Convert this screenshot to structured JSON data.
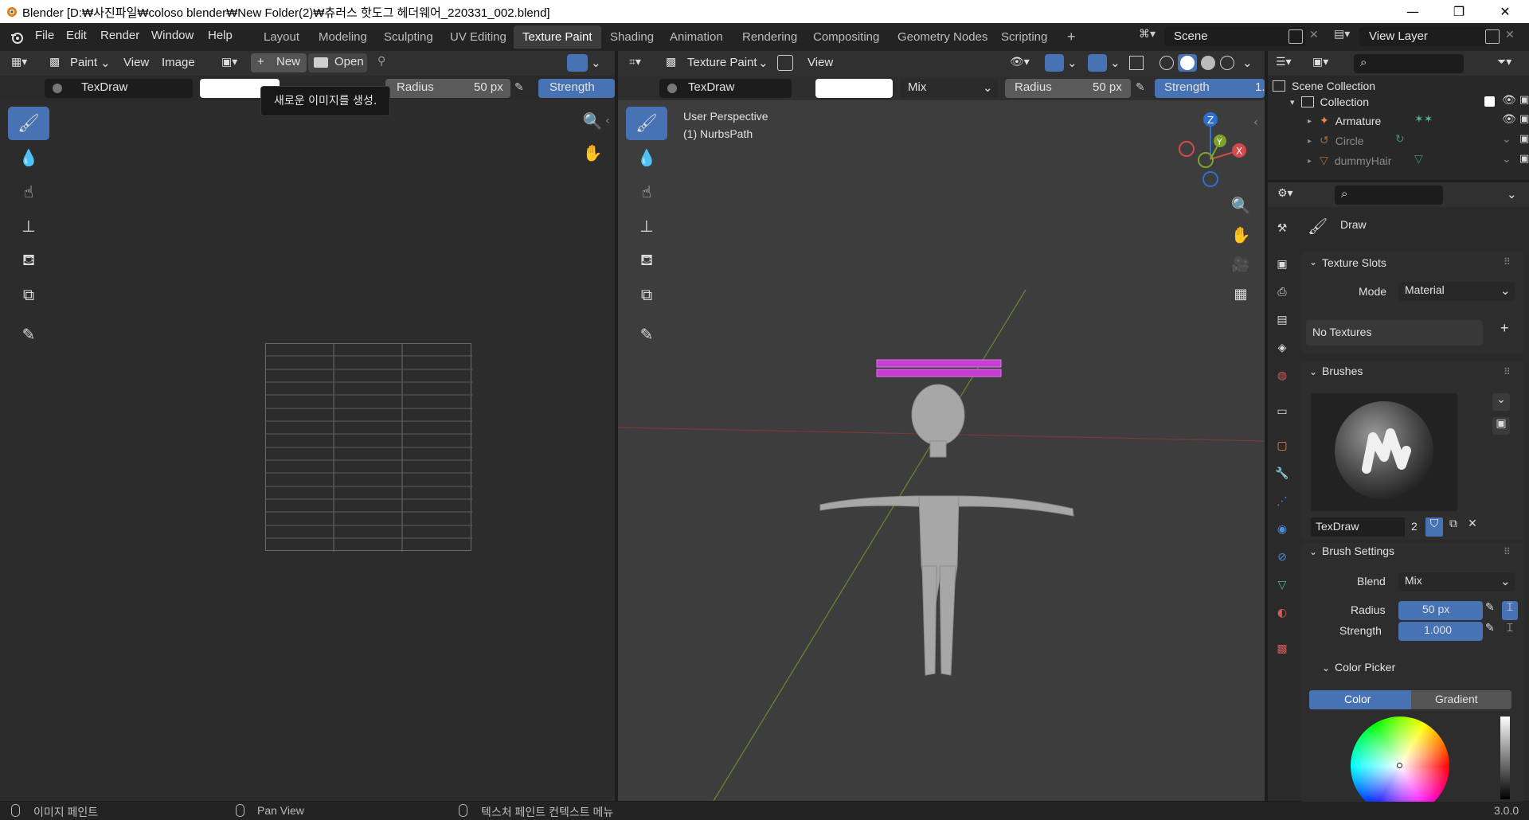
{
  "window": {
    "title": "Blender [D:₩사진파일₩coloso blender₩New Folder(2)₩츄러스 핫도그 헤더웨어_220331_002.blend]",
    "minimize": "—",
    "maximize": "❐",
    "close": "✕"
  },
  "menu": [
    "File",
    "Edit",
    "Render",
    "Window",
    "Help"
  ],
  "workspaces": {
    "tabs": [
      "Layout",
      "Modeling",
      "Sculpting",
      "UV Editing",
      "Texture Paint",
      "Shading",
      "Animation",
      "Rendering",
      "Compositing",
      "Geometry Nodes",
      "Scripting"
    ],
    "active": "Texture Paint",
    "add": "+"
  },
  "scene": {
    "name": "Scene"
  },
  "view_layer": {
    "name": "View Layer"
  },
  "image_editor": {
    "mode": "Paint",
    "menus": [
      "View",
      "Image"
    ],
    "new_label": "New",
    "open_label": "Open",
    "brush_name": "TexDraw",
    "radius_label": "Radius",
    "radius_value": "50 px",
    "strength_label": "Strength",
    "tooltip": "새로운 이미지를 생성."
  },
  "viewport": {
    "mode": "Texture Paint",
    "menu": "View",
    "brush_name": "TexDraw",
    "blend": "Mix",
    "radius_label": "Radius",
    "radius_value": "50 px",
    "strength_label": "Strength",
    "strength_value": "1.",
    "overlay_line1": "User Perspective",
    "overlay_line2": "(1) NurbsPath",
    "gizmo": {
      "x": "X",
      "y": "Y",
      "z": "Z"
    }
  },
  "outliner": {
    "scene_collection": "Scene Collection",
    "collection": "Collection",
    "items": [
      "Armature",
      "Circle",
      "dummyHair"
    ]
  },
  "properties": {
    "tool_name": "Draw",
    "texture_slots": {
      "title": "Texture Slots",
      "mode_label": "Mode",
      "mode_value": "Material",
      "empty": "No Textures",
      "add": "+"
    },
    "brushes": {
      "title": "Brushes",
      "brush_name": "TexDraw",
      "users": "2"
    },
    "brush_settings": {
      "title": "Brush Settings",
      "blend_label": "Blend",
      "blend_value": "Mix",
      "radius_label": "Radius",
      "radius_value": "50 px",
      "strength_label": "Strength",
      "strength_value": "1.000"
    },
    "color_picker": {
      "title": "Color Picker",
      "tab_color": "Color",
      "tab_gradient": "Gradient"
    }
  },
  "statusbar": {
    "left": "이미지 페인트",
    "middle": "Pan View",
    "right": "텍스처 페인트 컨텍스트 메뉴",
    "version": "3.0.0"
  },
  "colors": {
    "accent_blue": "#4772b3",
    "hair_magenta": "#c43fd0",
    "axis_red": "#d44a4a",
    "axis_green": "#7ca32c",
    "axis_blue": "#2f6fd0"
  }
}
